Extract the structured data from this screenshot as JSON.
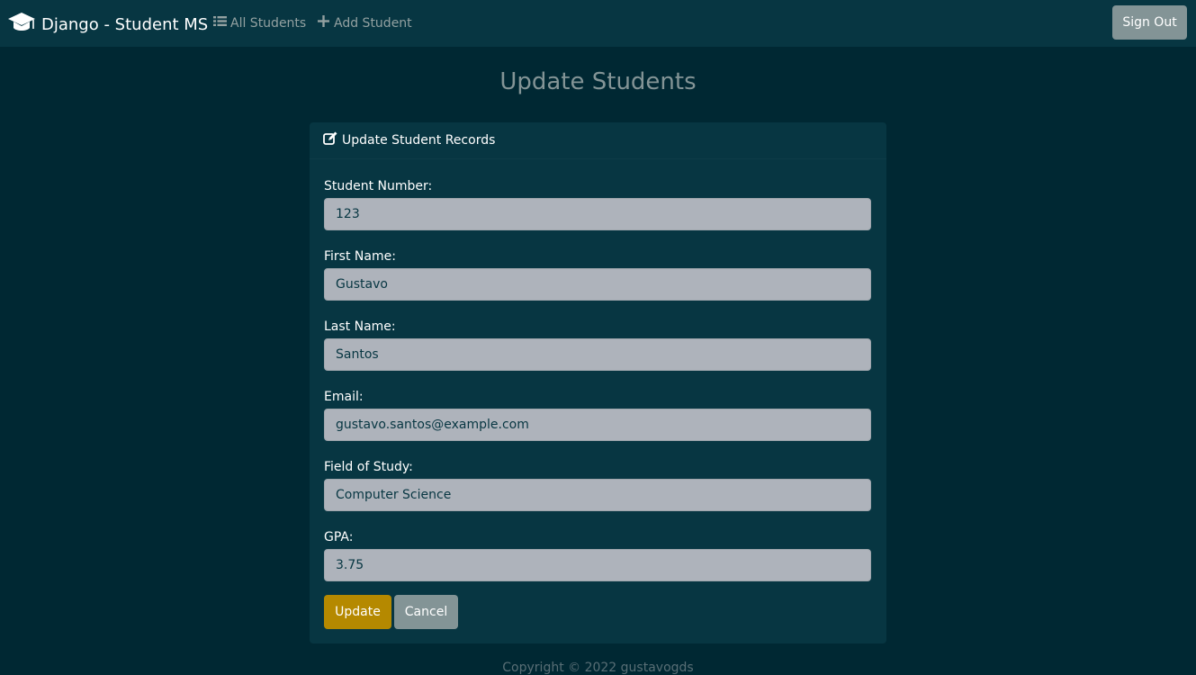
{
  "navbar": {
    "brand": "Django - Student MS",
    "brand_icon": "graduation-cap-icon",
    "links": [
      {
        "label": "All Students",
        "icon": "list-icon"
      },
      {
        "label": "Add Student",
        "icon": "plus-icon"
      }
    ],
    "sign_out": "Sign Out"
  },
  "page": {
    "title": "Update Students"
  },
  "card": {
    "header": "Update Student Records",
    "header_icon": "edit-icon",
    "fields": [
      {
        "label": "Student Number:",
        "value": "123"
      },
      {
        "label": "First Name:",
        "value": "Gustavo"
      },
      {
        "label": "Last Name:",
        "value": "Santos"
      },
      {
        "label": "Email:",
        "value": "gustavo.santos@example.com"
      },
      {
        "label": "Field of Study:",
        "value": "Computer Science"
      },
      {
        "label": "GPA:",
        "value": "3.75"
      }
    ],
    "update_button": "Update",
    "cancel_button": "Cancel"
  },
  "footer": {
    "text": "Copyright © 2022 gustavogds"
  },
  "colors": {
    "background": "#002833",
    "navbar": "#073642",
    "update_button": "#b58900",
    "secondary_button": "#839496"
  }
}
